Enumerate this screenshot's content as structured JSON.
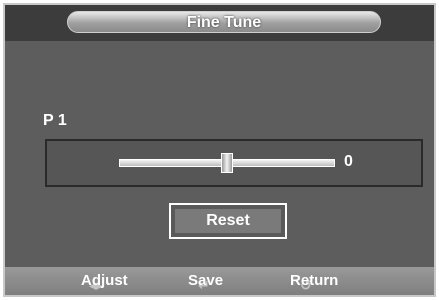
{
  "title": "Fine Tune",
  "channel": "P 1",
  "slider": {
    "value": "0",
    "level_fraction": 0.5
  },
  "reset_label": "Reset",
  "hints": {
    "adjust": "Adjust",
    "save": "Save",
    "return": "Return"
  },
  "icons": {
    "adjust": "left-right-arrows-icon",
    "save": "enter-icon",
    "return": "return-arrow-icon"
  },
  "colors": {
    "background": "#5d5d5d",
    "title_bar": "#3c3c3c",
    "bottom_bar": "#8c8c8c",
    "text": "#ffffff"
  }
}
